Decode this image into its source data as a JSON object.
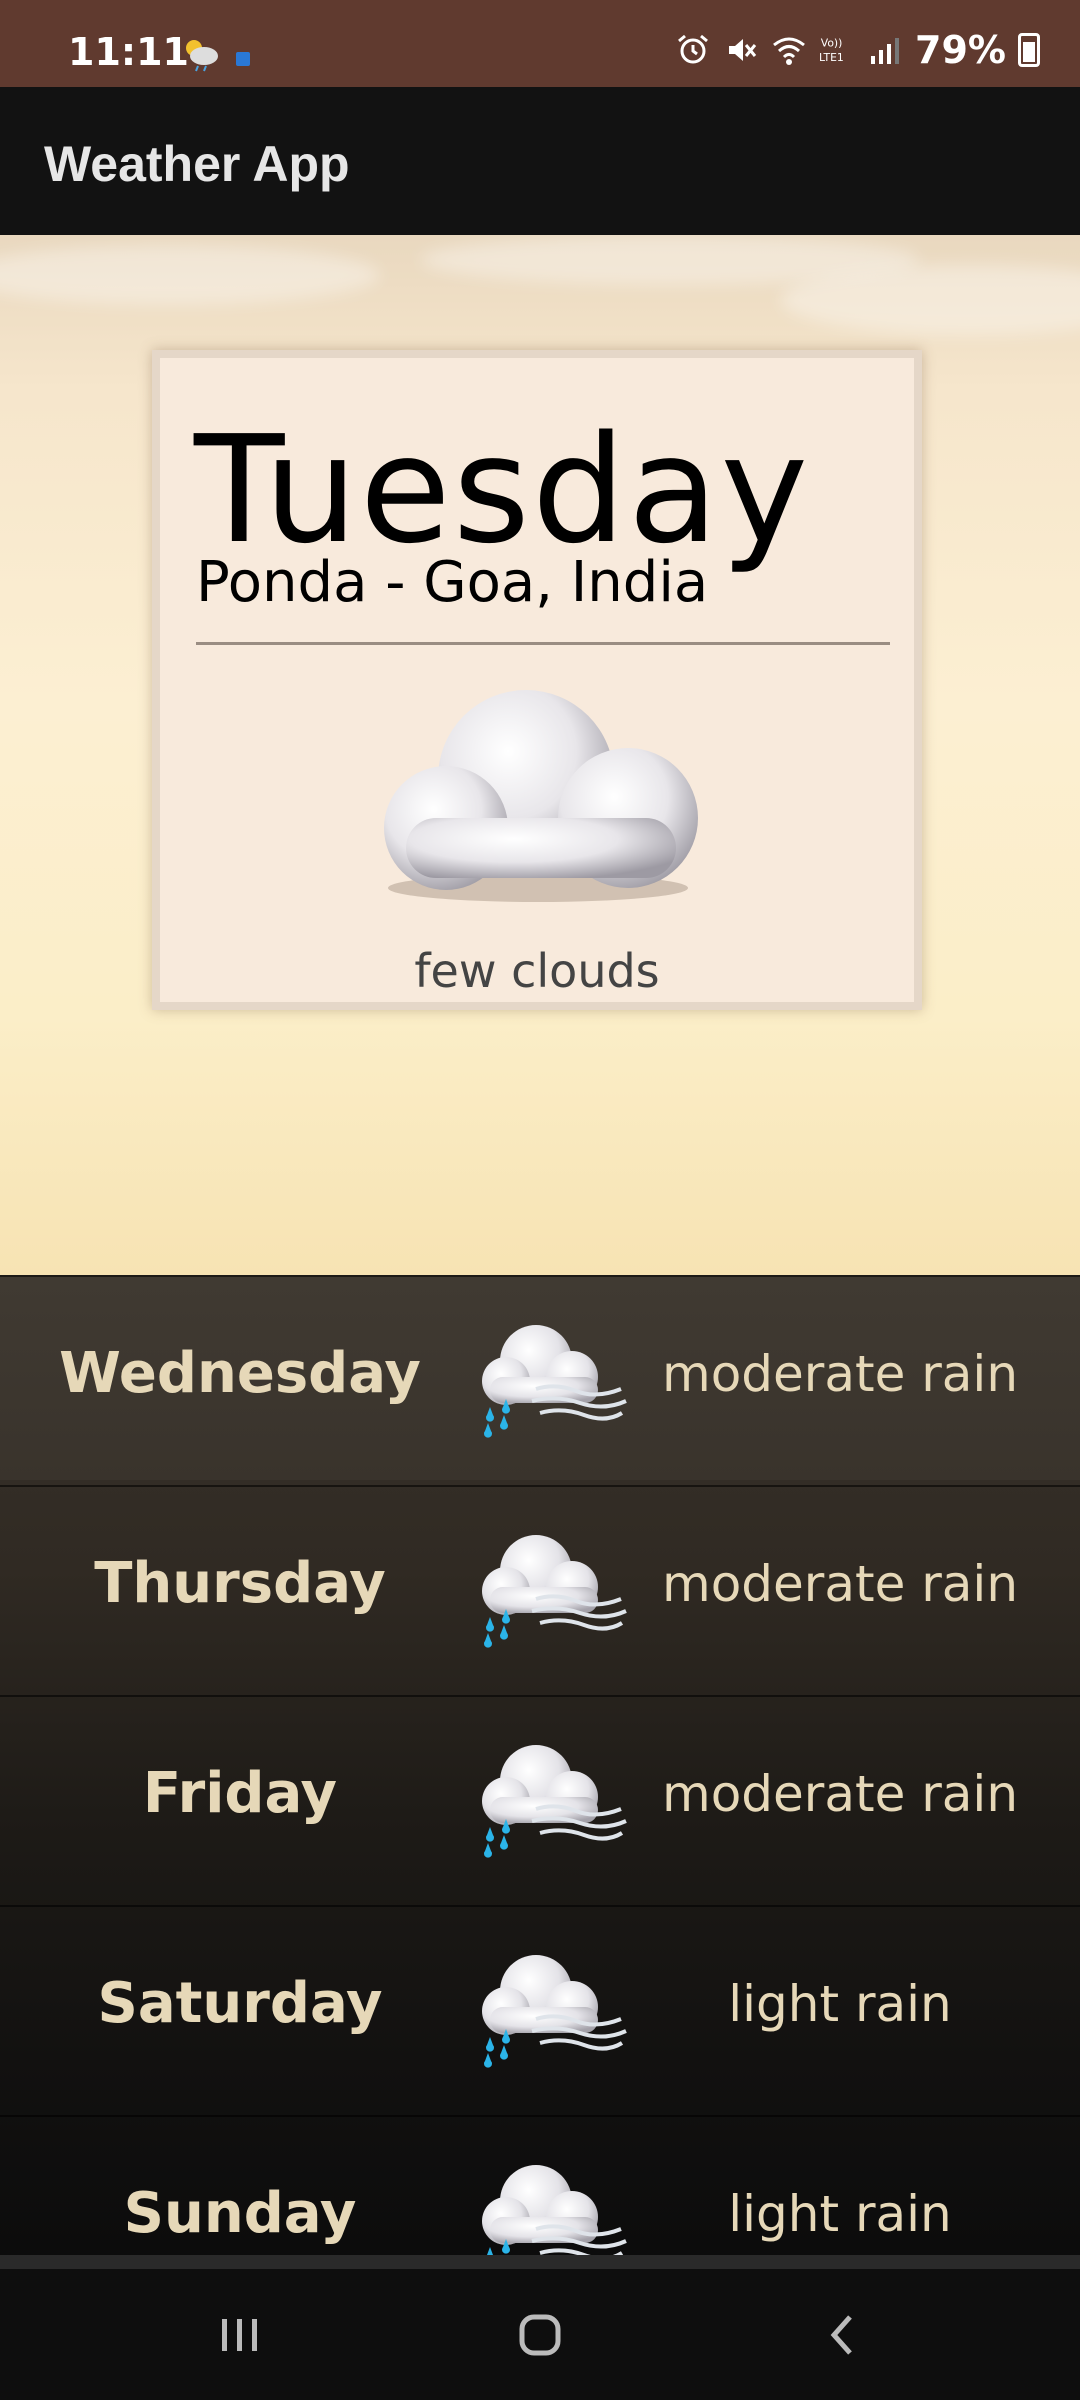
{
  "status_bar": {
    "time": "11:11",
    "battery": "79%",
    "icons": [
      "weather-notification-icon",
      "app-notification-icon",
      "alarm-icon",
      "mute-icon",
      "wifi-icon",
      "volte-lte-icon",
      "signal-icon",
      "battery-charging-icon"
    ]
  },
  "app_bar": {
    "title": "Weather App"
  },
  "today": {
    "day": "Tuesday",
    "location": "Ponda - Goa, India",
    "description": "few clouds",
    "icon": "cloud-icon"
  },
  "forecast": [
    {
      "day": "Wednesday",
      "description": "moderate rain",
      "icon": "rain-cloud-icon"
    },
    {
      "day": "Thursday",
      "description": "moderate rain",
      "icon": "rain-cloud-icon"
    },
    {
      "day": "Friday",
      "description": "moderate rain",
      "icon": "rain-cloud-icon"
    },
    {
      "day": "Saturday",
      "description": "light rain",
      "icon": "rain-cloud-icon"
    },
    {
      "day": "Sunday",
      "description": "light rain",
      "icon": "rain-cloud-icon"
    }
  ],
  "nav_bar": {
    "buttons": [
      "recent-apps-icon",
      "home-icon",
      "back-icon"
    ]
  },
  "colors": {
    "status_bar": "#603a2f",
    "app_bar": "#121212",
    "card": "#f8eadc",
    "forecast_text": "#e6d8b8"
  }
}
